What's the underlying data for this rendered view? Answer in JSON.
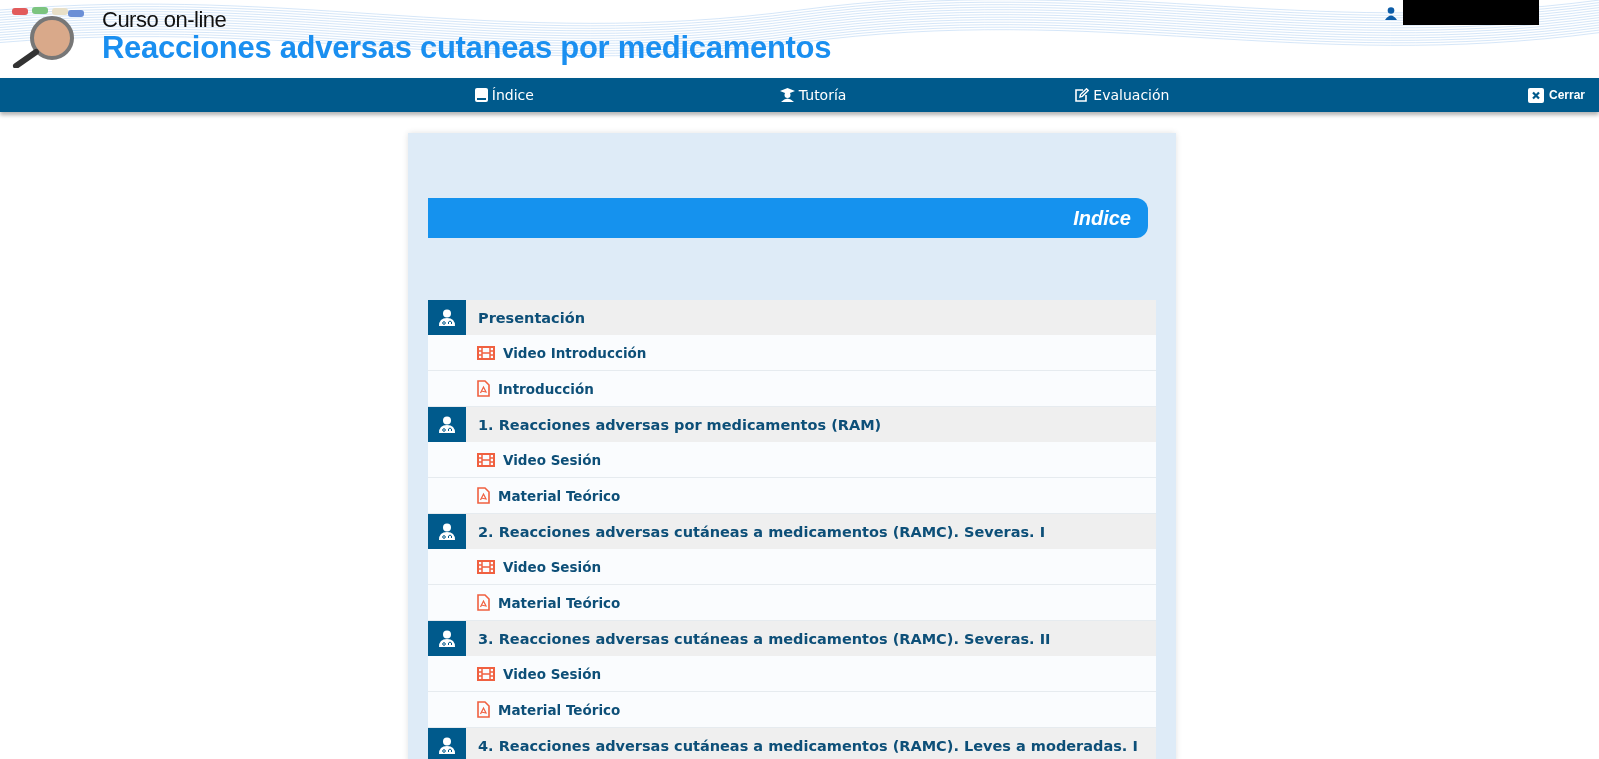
{
  "header": {
    "subtitle": "Curso on-line",
    "title": "Reacciones adversas cutaneas por medicamentos"
  },
  "nav": [
    {
      "kind": "book",
      "label": "Índice"
    },
    {
      "kind": "tutor",
      "label": "Tutoría"
    },
    {
      "kind": "edit",
      "label": "Evaluación"
    }
  ],
  "close_button": {
    "label": "Cerrar"
  },
  "index_title": "Indice",
  "sections": [
    {
      "title": "Presentación",
      "items": [
        {
          "kind": "video",
          "label": "Video Introducción"
        },
        {
          "kind": "pdf",
          "label": "Introducción"
        }
      ]
    },
    {
      "title": "1. Reacciones adversas por medicamentos (RAM)",
      "items": [
        {
          "kind": "video",
          "label": "Video Sesión"
        },
        {
          "kind": "pdf",
          "label": "Material Teórico"
        }
      ]
    },
    {
      "title": "2. Reacciones adversas cutáneas a medicamentos (RAMC). Severas. I",
      "items": [
        {
          "kind": "video",
          "label": "Video Sesión"
        },
        {
          "kind": "pdf",
          "label": "Material Teórico"
        }
      ]
    },
    {
      "title": "3. Reacciones adversas cutáneas a medicamentos (RAMC). Severas. II",
      "items": [
        {
          "kind": "video",
          "label": "Video Sesión"
        },
        {
          "kind": "pdf",
          "label": "Material Teórico"
        }
      ]
    },
    {
      "title": "4. Reacciones adversas cutáneas a medicamentos (RAMC). Leves a moderadas. I"
    }
  ]
}
